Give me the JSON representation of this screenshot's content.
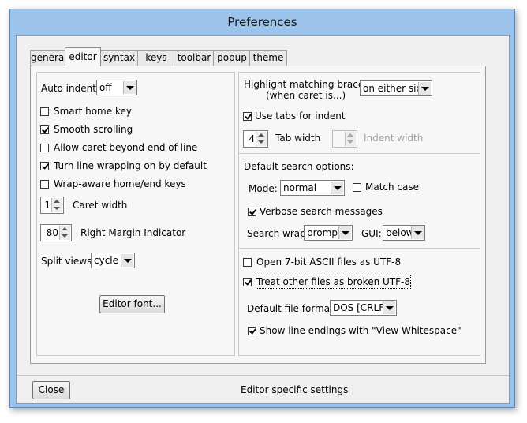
{
  "window": {
    "title": "Preferences"
  },
  "tabs": [
    {
      "label": "general"
    },
    {
      "label": "editor"
    },
    {
      "label": "syntax"
    },
    {
      "label": "keys"
    },
    {
      "label": "toolbar"
    },
    {
      "label": "popup"
    },
    {
      "label": "theme"
    }
  ],
  "active_tab": "editor",
  "left": {
    "auto_indent": {
      "label": "Auto indent:",
      "value": "off"
    },
    "checkboxes": [
      {
        "label": "Smart home key",
        "checked": false
      },
      {
        "label": "Smooth scrolling",
        "checked": true
      },
      {
        "label": "Allow caret beyond end of line",
        "checked": false
      },
      {
        "label": "Turn line wrapping on by default",
        "checked": true
      },
      {
        "label": "Wrap-aware home/end keys",
        "checked": false
      }
    ],
    "caret_width": {
      "label": "Caret width",
      "value": "1"
    },
    "right_margin": {
      "label": "Right Margin Indicator",
      "value": "80"
    },
    "split_views": {
      "label": "Split views:",
      "value": "cycle"
    },
    "editor_font_button": "Editor font..."
  },
  "right": {
    "highlight": {
      "label_line1": "Highlight matching braces",
      "label_line2": "(when caret is...)",
      "value": "on either side"
    },
    "use_tabs": {
      "label": "Use tabs for indent",
      "checked": true
    },
    "tab_width": {
      "label": "Tab width",
      "value": "4"
    },
    "indent_width": {
      "label": "Indent width",
      "value": ""
    },
    "search_heading": "Default search options:",
    "mode": {
      "label": "Mode:",
      "value": "normal"
    },
    "match_case": {
      "label": "Match case",
      "checked": false
    },
    "verbose": {
      "label": "Verbose search messages",
      "checked": true
    },
    "search_wrap": {
      "label": "Search wrap:",
      "value": "prompt"
    },
    "gui": {
      "label": "GUI:",
      "value": "below"
    },
    "open_ascii": {
      "label": "Open 7-bit ASCII files as UTF-8",
      "checked": false
    },
    "treat_broken": {
      "label": "Treat other files as broken UTF-8",
      "checked": true
    },
    "file_format": {
      "label": "Default file format:",
      "value": "DOS  [CRLF]"
    },
    "show_line_endings": {
      "label": "Show line endings with \"View Whitespace\"",
      "checked": true
    }
  },
  "footer": {
    "close_button": "Close",
    "status": "Editor specific settings"
  }
}
